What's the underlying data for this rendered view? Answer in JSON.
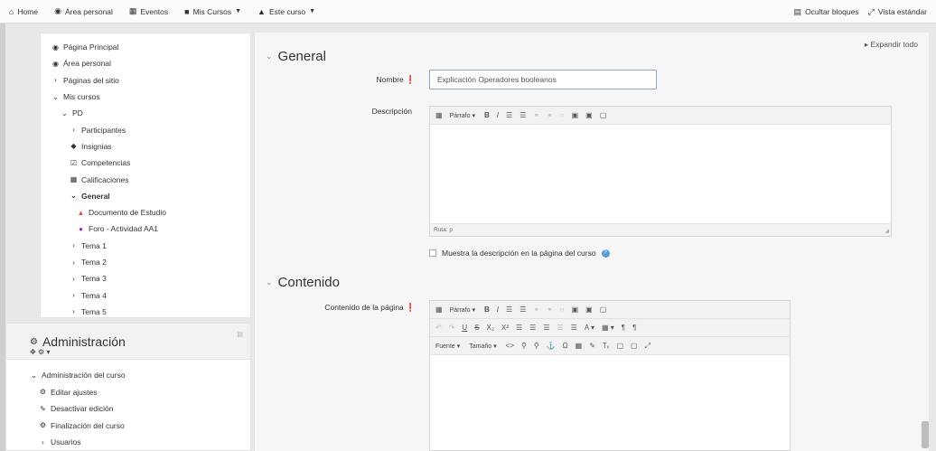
{
  "navbar": {
    "home": "Home",
    "area_personal": "Área personal",
    "eventos": "Eventos",
    "mis_cursos": "Mis Cursos",
    "este_curso": "Este curso",
    "ocultar_bloques": "Ocultar bloques",
    "vista_estandar": "Vista estándar"
  },
  "nav_tree": {
    "items": [
      {
        "label": "Página Principal"
      },
      {
        "label": "Área personal"
      },
      {
        "label": "Páginas del sitio"
      },
      {
        "label": "Mis cursos"
      },
      {
        "label": "PD"
      },
      {
        "label": "Participantes"
      },
      {
        "label": "Insignias"
      },
      {
        "label": "Competencias"
      },
      {
        "label": "Calificaciones"
      },
      {
        "label": "General"
      },
      {
        "label": "Documento de Estudio"
      },
      {
        "label": "Foro - Actividad AA1"
      },
      {
        "label": "Tema 1"
      },
      {
        "label": "Tema 2"
      },
      {
        "label": "Tema 3"
      },
      {
        "label": "Tema 4"
      },
      {
        "label": "Tema 5"
      }
    ]
  },
  "admin": {
    "title": "Administración",
    "items": [
      {
        "label": "Administración del curso"
      },
      {
        "label": "Editar ajustes"
      },
      {
        "label": "Desactivar edición"
      },
      {
        "label": "Finalización del curso"
      },
      {
        "label": "Usuarios"
      }
    ]
  },
  "main": {
    "expand_all": "Expandir todo",
    "general_title": "General",
    "nombre_label": "Nombre",
    "nombre_value": "Explicación Operadores booleanos",
    "descripcion_label": "Descripción",
    "parrafo": "Párrafo",
    "ruta": "Ruta: p",
    "mostrar_descripcion": "Muestra la descripción en la página del curso",
    "contenido_title": "Contenido",
    "contenido_label": "Contenido de la página",
    "fuente": "Fuente",
    "tamano": "Tamaño"
  },
  "colors": {
    "required": "#c9302c",
    "help": "#5b9bd5",
    "input_border": "#8aa8c8"
  }
}
